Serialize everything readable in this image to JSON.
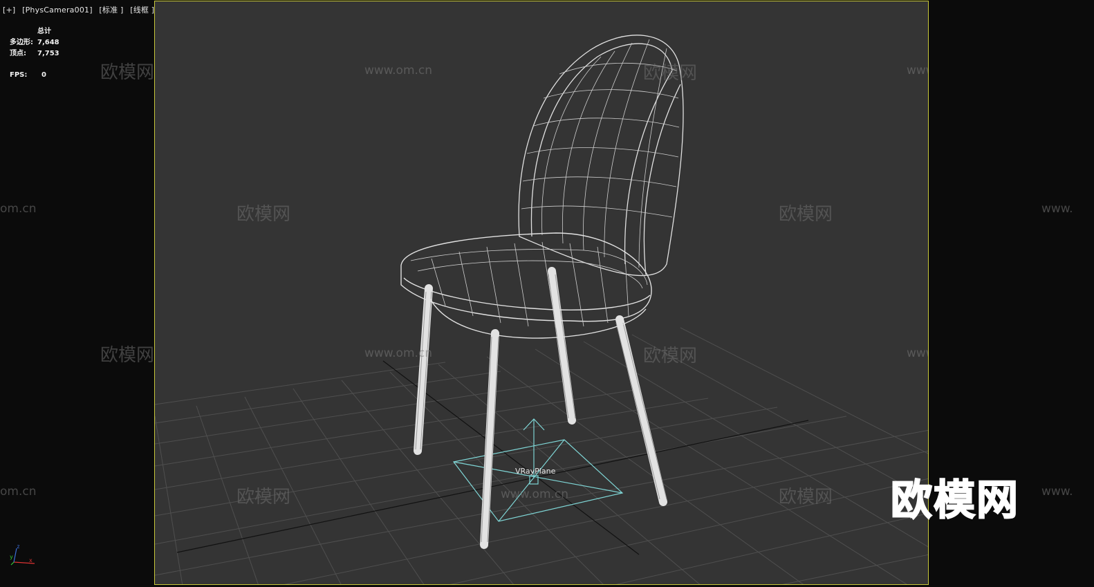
{
  "viewport": {
    "menu_button": "[+]",
    "camera": "[PhysCamera001]",
    "shading": "[标准 ]",
    "display_mode": "[线框 ]"
  },
  "stats": {
    "title": "总计",
    "polys_label": "多边形:",
    "polys_value": "7,648",
    "verts_label": "顶点:",
    "verts_value": "7,753",
    "fps_label": "FPS:",
    "fps_value": "0"
  },
  "scene": {
    "helper_label": "VRayPlane",
    "wireframe_color": "#e6e6e6",
    "helper_color": "#7fd6d6",
    "background_color": "#343434",
    "frame_color": "#c8c83a"
  },
  "watermarks": {
    "url_text": "www.om.cn",
    "cn_text": "欧模网",
    "partial_url_left": "om.cn",
    "partial_url_right": "www."
  },
  "brand": {
    "logo_text": "欧模网"
  },
  "axis_tripod": {
    "x": "x",
    "y": "y",
    "z": "z"
  }
}
